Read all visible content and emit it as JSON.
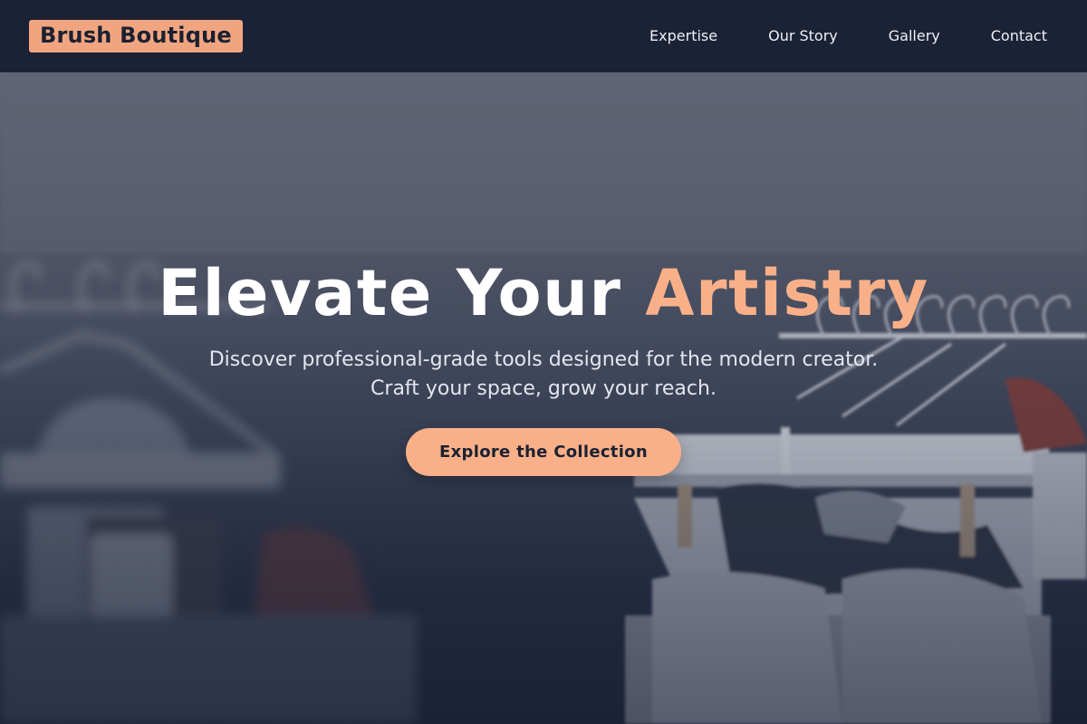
{
  "brand": {
    "name": "Brush Boutique",
    "accent_color": "#f0a580"
  },
  "nav": {
    "links": [
      {
        "label": "Expertise"
      },
      {
        "label": "Our Story"
      },
      {
        "label": "Gallery"
      },
      {
        "label": "Contact"
      }
    ]
  },
  "hero": {
    "title_main": "Elevate Your",
    "title_accent": "Artistry",
    "subtitle_line1": "Discover professional-grade tools designed for the modern creator.",
    "subtitle_line2": "Craft your space, grow your reach.",
    "cta_label": "Explore the Collection",
    "background_image": "clothing-rack-photo"
  },
  "colors": {
    "nav_background": "#1c2236",
    "accent": "#f9b088",
    "text_light": "#ffffff"
  }
}
